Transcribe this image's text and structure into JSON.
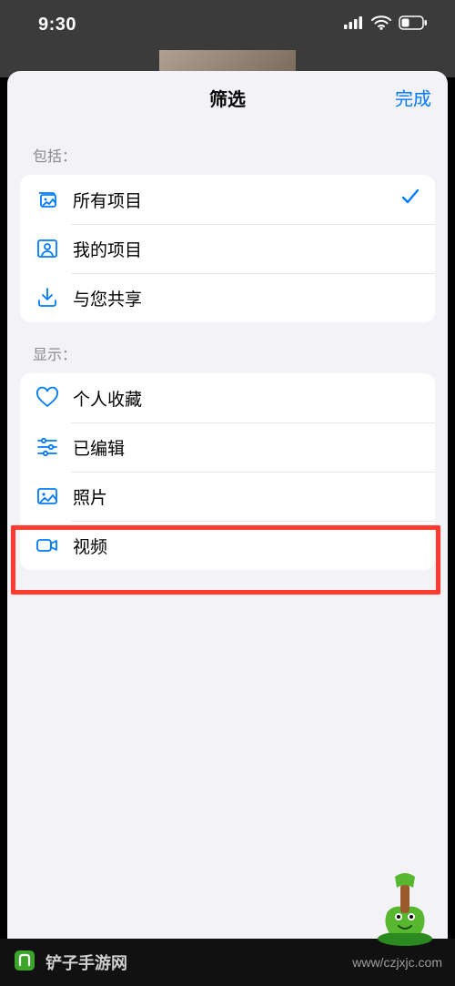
{
  "status": {
    "time": "9:30"
  },
  "sheet": {
    "title": "筛选",
    "done": "完成",
    "sections": {
      "include": {
        "label": "包括：",
        "items": [
          {
            "icon": "gallery-stack-icon",
            "label": "所有项目",
            "selected": true
          },
          {
            "icon": "person-frame-icon",
            "label": "我的项目",
            "selected": false
          },
          {
            "icon": "download-tray-icon",
            "label": "与您共享",
            "selected": false
          }
        ]
      },
      "show": {
        "label": "显示：",
        "items": [
          {
            "icon": "heart-icon",
            "label": "个人收藏"
          },
          {
            "icon": "sliders-icon",
            "label": "已编辑"
          },
          {
            "icon": "photo-icon",
            "label": "照片"
          },
          {
            "icon": "video-icon",
            "label": "视频"
          }
        ]
      }
    }
  },
  "watermark": {
    "site_name": "铲子手游网",
    "url": "www/czjxjc.com"
  }
}
